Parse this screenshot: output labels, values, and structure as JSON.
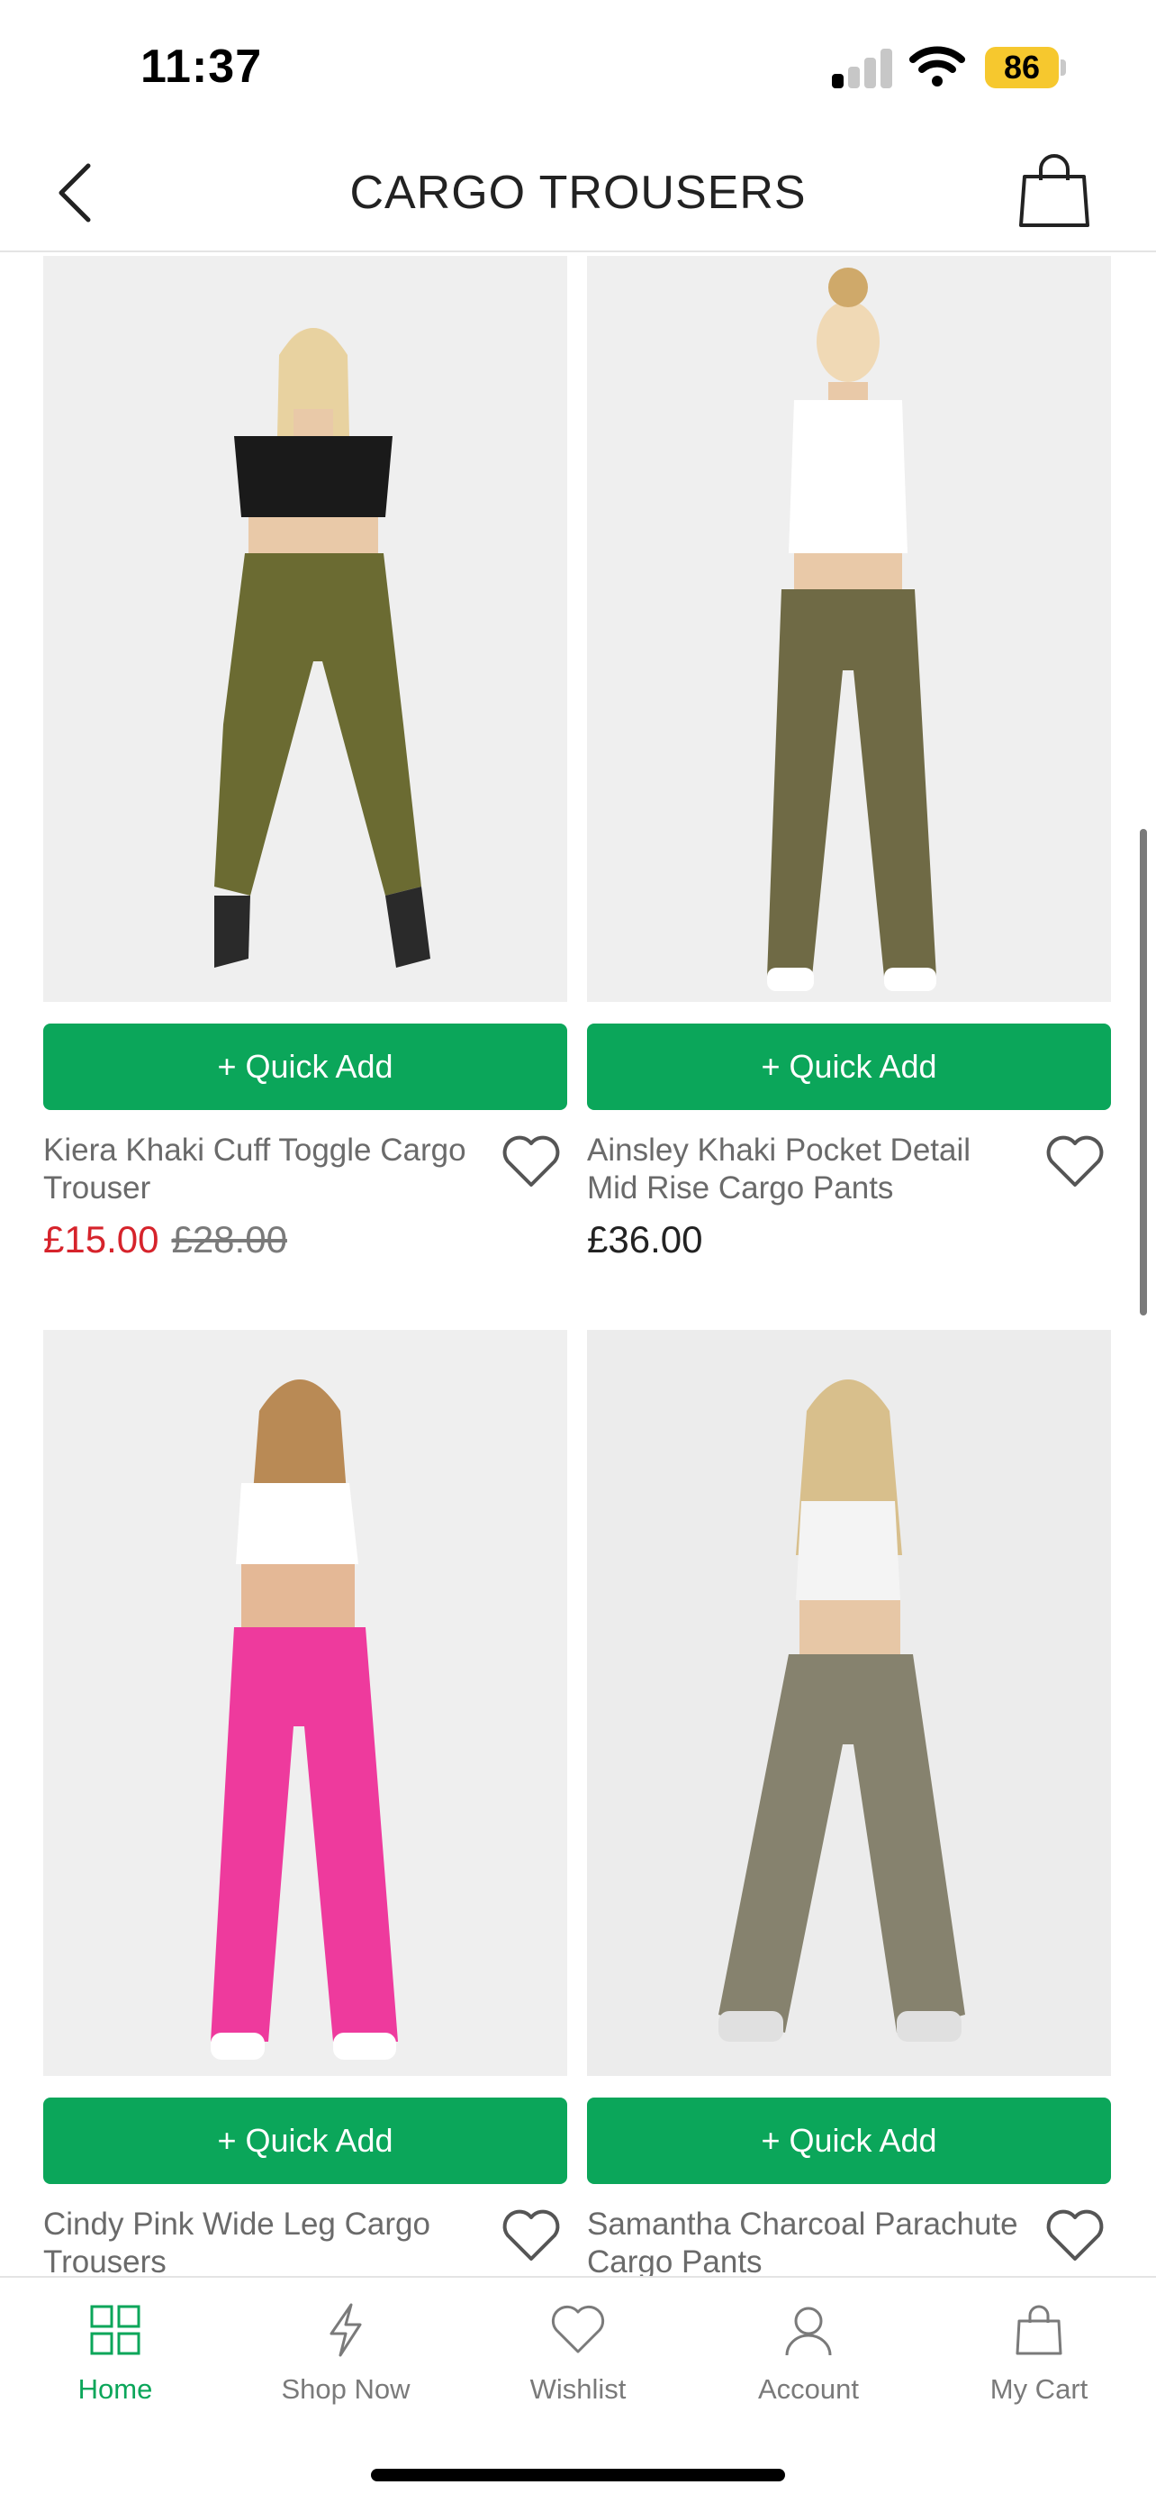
{
  "status_bar": {
    "time": "11:37",
    "battery": "86"
  },
  "header": {
    "title": "CARGO TROUSERS"
  },
  "products": [
    {
      "quick_add": "+ Quick Add",
      "name": "Kiera Khaki Cuff Toggle Cargo Trouser",
      "price_sale": "£15.00",
      "price_old": "£28.00"
    },
    {
      "quick_add": "+ Quick Add",
      "name": "Ainsley Khaki Pocket Detail Mid Rise Cargo Pants",
      "price": "£36.00"
    },
    {
      "quick_add": "+ Quick Add",
      "name": "Cindy Pink Wide Leg Cargo Trousers"
    },
    {
      "quick_add": "+ Quick Add",
      "name": "Samantha Charcoal Parachute Cargo Pants"
    }
  ],
  "tabs": [
    {
      "label": "Home",
      "icon": "grid-icon",
      "active": true
    },
    {
      "label": "Shop Now",
      "icon": "lightning-icon"
    },
    {
      "label": "Wishlist",
      "icon": "heart-icon"
    },
    {
      "label": "Account",
      "icon": "person-icon"
    },
    {
      "label": "My Cart",
      "icon": "bag-icon"
    }
  ],
  "colors": {
    "accent": "#0ba65a",
    "sale": "#d6232b",
    "battery": "#f6c82e"
  }
}
